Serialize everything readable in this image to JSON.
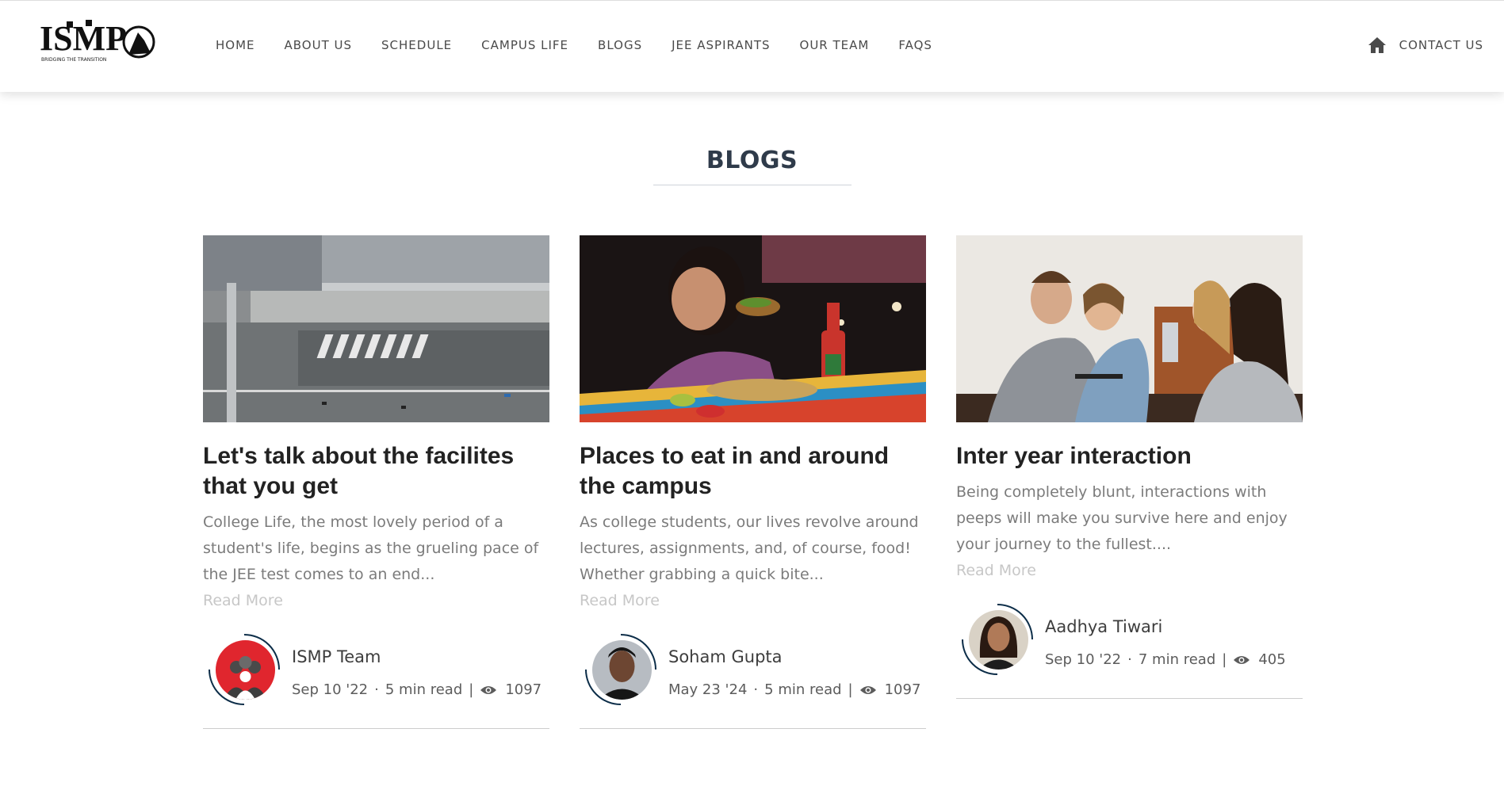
{
  "logo": {
    "text": "ISMP",
    "tagline": "BRIDGING THE TRANSITION"
  },
  "nav": {
    "links": [
      "HOME",
      "ABOUT US",
      "SCHEDULE",
      "CAMPUS LIFE",
      "BLOGS",
      "JEE ASPIRANTS",
      "OUR TEAM",
      "FAQS"
    ],
    "contact": "CONTACT US",
    "contact_icon": "home-icon"
  },
  "section": {
    "title": "BLOGS"
  },
  "colors": {
    "accent": "#0c2d48",
    "avatar_red": "#e0262e",
    "text_dark": "#222222",
    "text_muted": "#7b7b7b",
    "read_more": "#c7c7c7"
  },
  "blogs": [
    {
      "title": "Let's talk about the facilites that you get",
      "excerpt": "College Life, the most lovely period of a student's life, begins as the grueling pace of the JEE test comes to an end...",
      "read_more": "Read More",
      "author": "ISMP Team",
      "date": "Sep 10 '22",
      "read_time": "5 min read",
      "views": "1097",
      "image": "aerial-campus-photo"
    },
    {
      "title": "Places to eat in and around the campus",
      "excerpt": "As college students, our lives revolve around lectures, assignments, and, of course, food! Whether grabbing a quick bite...",
      "read_more": "Read More",
      "author": "Soham Gupta",
      "date": "May 23 '24",
      "read_time": "5 min read",
      "views": "1097",
      "image": "woman-eating-taco-photo"
    },
    {
      "title": "Inter year interaction",
      "excerpt": "Being completely blunt, interactions with peeps will make you survive here and enjoy your journey to the fullest....",
      "read_more": "Read More",
      "author": "Aadhya Tiwari",
      "date": "Sep 10 '22",
      "read_time": "7 min read",
      "views": "405",
      "image": "students-talking-photo"
    }
  ]
}
